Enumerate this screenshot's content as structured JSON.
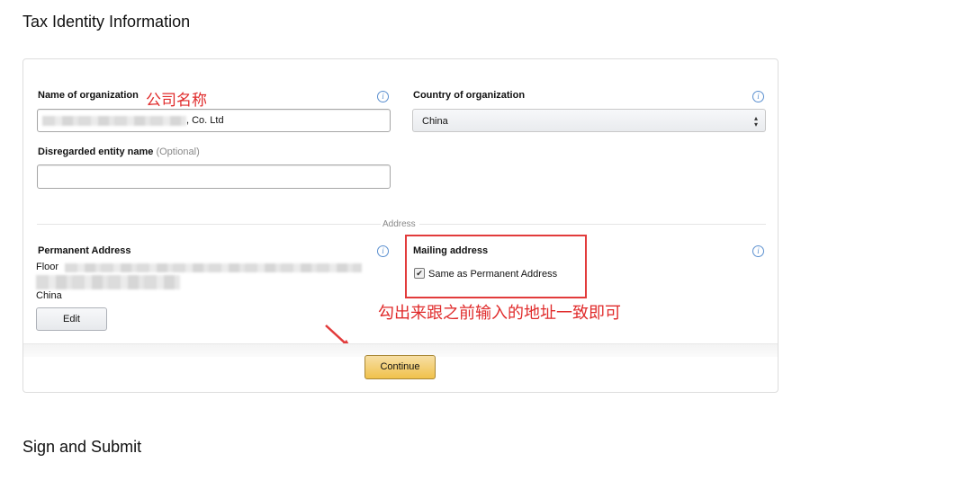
{
  "sections": {
    "tax_identity_title": "Tax Identity Information",
    "sign_submit_title": "Sign and Submit"
  },
  "form": {
    "name_label": "Name of organization",
    "name_value_suffix": ", Co. Ltd",
    "country_label": "Country of organization",
    "country_value": "China",
    "disregarded_label": "Disregarded entity name",
    "disregarded_optional": "(Optional)",
    "disregarded_value": "",
    "address_divider": "Address",
    "permanent_label": "Permanent Address",
    "permanent_line1_prefix": "Floor",
    "permanent_country": "China",
    "edit_label": "Edit",
    "mailing_label": "Mailing address",
    "same_as_label": "Same as Permanent Address",
    "same_as_checked": true,
    "continue_label": "Continue"
  },
  "annotations": {
    "company_name_note": "公司名称",
    "mailing_note": "勾出来跟之前输入的地址一致即可",
    "color": "#e02b2b"
  },
  "icons": {
    "info": "info-icon",
    "select_arrow": "select-arrow-icon",
    "checkbox": "checkbox-icon",
    "annotation_arrow": "annotation-arrow-icon"
  },
  "colors": {
    "continue_button": "#f0c14b",
    "annotation_red": "#e23b3b",
    "info_blue": "#5a8fcf"
  }
}
